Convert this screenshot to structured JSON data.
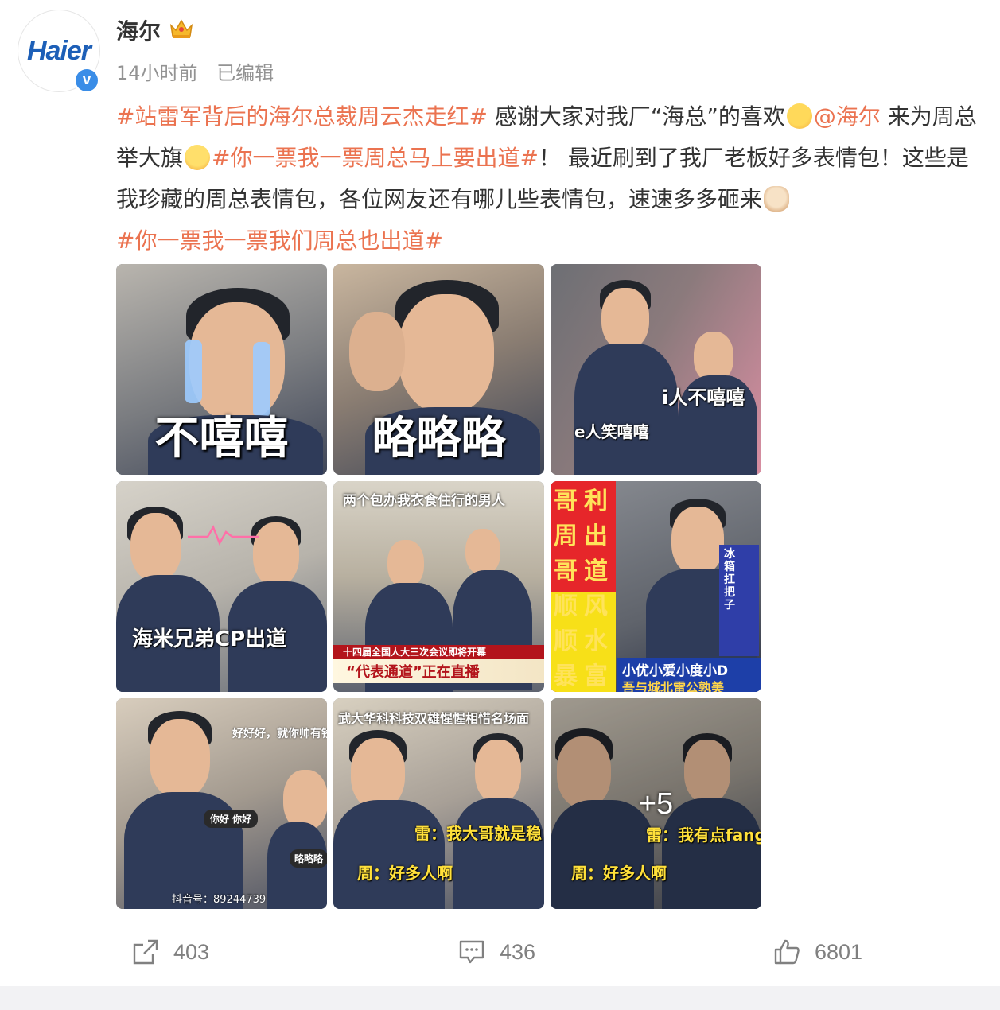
{
  "post": {
    "author": "海尔",
    "avatar_logo": "Haier",
    "verified_mark": "v",
    "time": "14小时前",
    "edited": "已编辑",
    "text": {
      "tag1": "#站雷军背后的海尔总裁周云杰走红#",
      "t1": " 感谢大家对我厂“海总”的喜欢",
      "mention": "@海尔",
      "t2": " 来为周总举大旗",
      "tag2": "#你一票我一票周总马上要出道#",
      "t3": "！ 最近刷到了我厂老板好多表情包！这些是我珍藏的周总表情包，各位网友还有哪儿些表情包，速速多多砸来",
      "tag3": "#你一票我一票我们周总也出道#"
    }
  },
  "images": [
    {
      "caption": "不嘻嘻"
    },
    {
      "caption": "略略略"
    },
    {
      "caption_a": "i人不嘻嘻",
      "caption_b": "e人笑嘻嘻"
    },
    {
      "caption": "海米兄弟CP出道"
    },
    {
      "caption_top": "两个包办我衣食住行的男人",
      "banner_a": "十四届全国人大三次会议即将开幕",
      "banner_b": "“代表通道”正在直播"
    },
    {
      "col1": "哥周哥顺顺暴暴",
      "col2": "利出道风水富美",
      "side": "冰箱扛把子",
      "bottom_a": "小优小爱小度小D",
      "bottom_b": "吾与城北雷公孰美"
    },
    {
      "bubble_a": "好好好，就你帅有钱",
      "bubble_b": "你好 你好",
      "bubble_c": "略略略",
      "watermark": "抖音号：89244739"
    },
    {
      "caption_top": "武大华科科技双雄惺惺相惜名场面",
      "line_a": "雷：我大哥就是稳",
      "line_b": "周：好多人啊"
    },
    {
      "more": "+5",
      "line_a": "雷：我有点fang",
      "line_b": "周：好多人啊"
    }
  ],
  "actions": {
    "share_count": "403",
    "comment_count": "436",
    "like_count": "6801"
  },
  "colors": {
    "link": "#eb7350",
    "meta": "#939393",
    "text": "#333333",
    "verified": "#3a8de7"
  }
}
